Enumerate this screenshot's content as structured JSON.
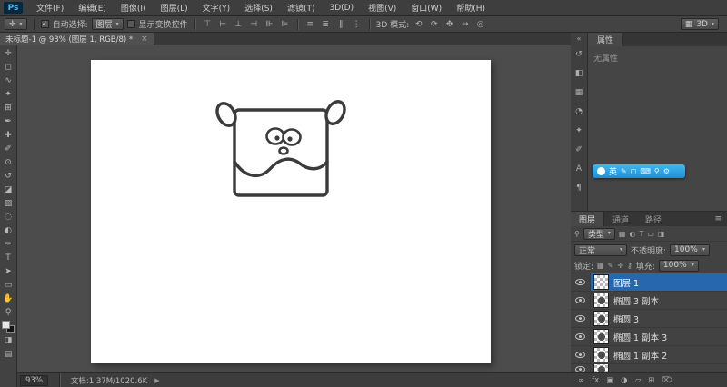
{
  "app": {
    "logo": "Ps"
  },
  "menu": {
    "items": [
      "文件(F)",
      "编辑(E)",
      "图像(I)",
      "图层(L)",
      "文字(Y)",
      "选择(S)",
      "滤镜(T)",
      "3D(D)",
      "视图(V)",
      "窗口(W)",
      "帮助(H)"
    ]
  },
  "ui": {
    "caret": "▾",
    "check": "✓",
    "close": "×",
    "collapse": "«",
    "search": "⚲",
    "arrow": "▶",
    "menu": "≡",
    "grid": "▦"
  },
  "options_bar": {
    "tool_glyph": "✛",
    "auto_select": {
      "checked": true,
      "label": "自动选择:",
      "value": "图层"
    },
    "show_transform_label": "显示变换控件",
    "align_icons": [
      {
        "name": "align-top-icon",
        "glyph": "⊤"
      },
      {
        "name": "align-middle-icon",
        "glyph": "⊢"
      },
      {
        "name": "align-bottom-icon",
        "glyph": "⊥"
      },
      {
        "name": "align-left-icon",
        "glyph": "⊣"
      },
      {
        "name": "align-center-icon",
        "glyph": "⊪"
      },
      {
        "name": "align-right-icon",
        "glyph": "⊫"
      }
    ],
    "distribute_icons": [
      {
        "name": "distribute-top-icon",
        "glyph": "≡"
      },
      {
        "name": "distribute-middle-icon",
        "glyph": "≣"
      },
      {
        "name": "distribute-bottom-icon",
        "glyph": "∥"
      },
      {
        "name": "distribute-left-icon",
        "glyph": "⋮"
      }
    ],
    "mode_label": "3D 模式:",
    "mode_icons": [
      {
        "name": "3d-rotate-icon",
        "glyph": "⟲"
      },
      {
        "name": "3d-roll-icon",
        "glyph": "⟳"
      },
      {
        "name": "3d-pan-icon",
        "glyph": "✥"
      },
      {
        "name": "3d-slide-icon",
        "glyph": "↔"
      },
      {
        "name": "3d-scale-icon",
        "glyph": "◎"
      }
    ],
    "workspace": "3D"
  },
  "document": {
    "tab_title": "未标题-1 @ 93% (图层 1, RGB/8) *"
  },
  "tools": [
    {
      "name": "move-tool",
      "glyph": "✛"
    },
    {
      "name": "marquee-tool",
      "glyph": "◻"
    },
    {
      "name": "lasso-tool",
      "glyph": "∿"
    },
    {
      "name": "quick-selection-tool",
      "glyph": "✦"
    },
    {
      "name": "crop-tool",
      "glyph": "⊞"
    },
    {
      "name": "eyedropper-tool",
      "glyph": "✒"
    },
    {
      "name": "healing-brush-tool",
      "glyph": "✚"
    },
    {
      "name": "brush-tool",
      "glyph": "✐"
    },
    {
      "name": "clone-stamp-tool",
      "glyph": "⊙"
    },
    {
      "name": "history-brush-tool",
      "glyph": "↺"
    },
    {
      "name": "eraser-tool",
      "glyph": "◪"
    },
    {
      "name": "gradient-tool",
      "glyph": "▨"
    },
    {
      "name": "blur-tool",
      "glyph": "◌"
    },
    {
      "name": "dodge-tool",
      "glyph": "◐"
    },
    {
      "name": "pen-tool",
      "glyph": "✑"
    },
    {
      "name": "type-tool",
      "glyph": "T"
    },
    {
      "name": "path-selection-tool",
      "glyph": "➤"
    },
    {
      "name": "shape-tool",
      "glyph": "▭"
    },
    {
      "name": "hand-tool",
      "glyph": "✋"
    },
    {
      "name": "zoom-tool",
      "glyph": "⚲"
    }
  ],
  "dock_icons": [
    {
      "name": "history-panel-icon",
      "glyph": "↺"
    },
    {
      "name": "color-panel-icon",
      "glyph": "◧"
    },
    {
      "name": "swatches-panel-icon",
      "glyph": "▦"
    },
    {
      "name": "adjustments-panel-icon",
      "glyph": "◔"
    },
    {
      "name": "styles-panel-icon",
      "glyph": "✦"
    },
    {
      "name": "brush-panel-icon",
      "glyph": "✐"
    },
    {
      "name": "character-panel-icon",
      "glyph": "A"
    },
    {
      "name": "paragraph-panel-icon",
      "glyph": "¶"
    }
  ],
  "properties": {
    "tab": "属性",
    "empty_text": "无属性"
  },
  "ime": {
    "mode": "英",
    "icons": [
      {
        "name": "ime-pen-icon",
        "glyph": "✎"
      },
      {
        "name": "ime-board-icon",
        "glyph": "◻"
      },
      {
        "name": "ime-keyboard-icon",
        "glyph": "⌨"
      },
      {
        "name": "ime-search-icon",
        "glyph": "⚲"
      },
      {
        "name": "ime-settings-icon",
        "glyph": "⚙"
      }
    ]
  },
  "layers": {
    "tabs": [
      "图层",
      "通道",
      "路径"
    ],
    "filter_label": "类型",
    "filter_icons": [
      {
        "name": "filter-pixel-icon",
        "glyph": "▦"
      },
      {
        "name": "filter-adjustment-icon",
        "glyph": "◐"
      },
      {
        "name": "filter-type-icon",
        "glyph": "T"
      },
      {
        "name": "filter-shape-icon",
        "glyph": "▭"
      },
      {
        "name": "filter-smart-icon",
        "glyph": "◨"
      }
    ],
    "blend_mode": "正常",
    "opacity_label": "不透明度:",
    "opacity_value": "100%",
    "lock_label": "锁定:",
    "lock_icons": [
      {
        "name": "lock-transparency-icon",
        "glyph": "▦"
      },
      {
        "name": "lock-pixels-icon",
        "glyph": "✎"
      },
      {
        "name": "lock-position-icon",
        "glyph": "✛"
      },
      {
        "name": "lock-all-icon",
        "glyph": "⚷"
      }
    ],
    "fill_label": "填充:",
    "fill_value": "100%",
    "rows": [
      {
        "name": "图层 1",
        "selected": true,
        "thumb": "empty"
      },
      {
        "name": "椭圆 3 副本",
        "selected": false,
        "thumb": "shape"
      },
      {
        "name": "椭圆 3",
        "selected": false,
        "thumb": "shape"
      },
      {
        "name": "椭圆 1 副本 3",
        "selected": false,
        "thumb": "shape"
      },
      {
        "name": "椭圆 1 副本 2",
        "selected": false,
        "thumb": "shape"
      },
      {
        "name": "",
        "selected": false,
        "thumb": "shape"
      }
    ],
    "footer_icons": [
      {
        "name": "link-layers-icon",
        "glyph": "∞"
      },
      {
        "name": "layer-effects-icon",
        "glyph": "fx"
      },
      {
        "name": "layer-mask-icon",
        "glyph": "▣"
      },
      {
        "name": "adjustment-layer-icon",
        "glyph": "◑"
      },
      {
        "name": "layer-group-icon",
        "glyph": "▱"
      },
      {
        "name": "new-layer-icon",
        "glyph": "⊞"
      },
      {
        "name": "delete-layer-icon",
        "glyph": "⌦"
      }
    ]
  },
  "status": {
    "zoom": "93%",
    "info": "文档:1.37M/1020.6K"
  },
  "colors": {
    "accent_blue": "#2667ad",
    "ime_blue": "#2ea7e0",
    "logo_bg": "#04283f",
    "logo_text": "#57b7f2"
  }
}
